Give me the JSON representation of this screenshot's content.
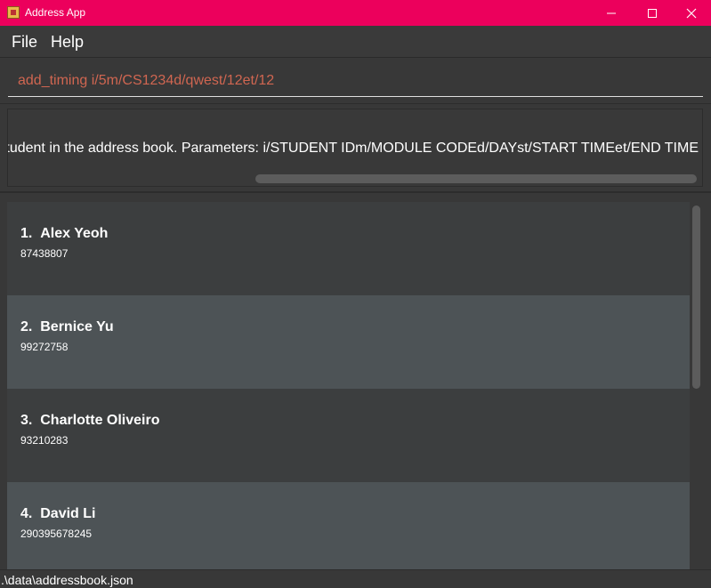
{
  "window": {
    "title": "Address App",
    "icon": "address-book-icon",
    "accent_color": "#ec005c"
  },
  "menu": {
    "file_label": "File",
    "help_label": "Help"
  },
  "command": {
    "value": "add_timing i/5m/CS1234d/qwest/12et/12",
    "text_color": "#d06651"
  },
  "result": {
    "text": "Adds a timing for a student in the address book. Parameters: i/STUDENT IDm/MODULE CODEd/DAYst/START TIMEet/END TIME"
  },
  "persons": [
    {
      "index": "1.",
      "name": "Alex Yeoh",
      "phone": "87438807"
    },
    {
      "index": "2.",
      "name": "Bernice Yu",
      "phone": "99272758"
    },
    {
      "index": "3.",
      "name": "Charlotte Oliveiro",
      "phone": "93210283"
    },
    {
      "index": "4.",
      "name": "David Li",
      "phone": "290395678245"
    }
  ],
  "status": {
    "file_path": ".\\data\\addressbook.json"
  }
}
